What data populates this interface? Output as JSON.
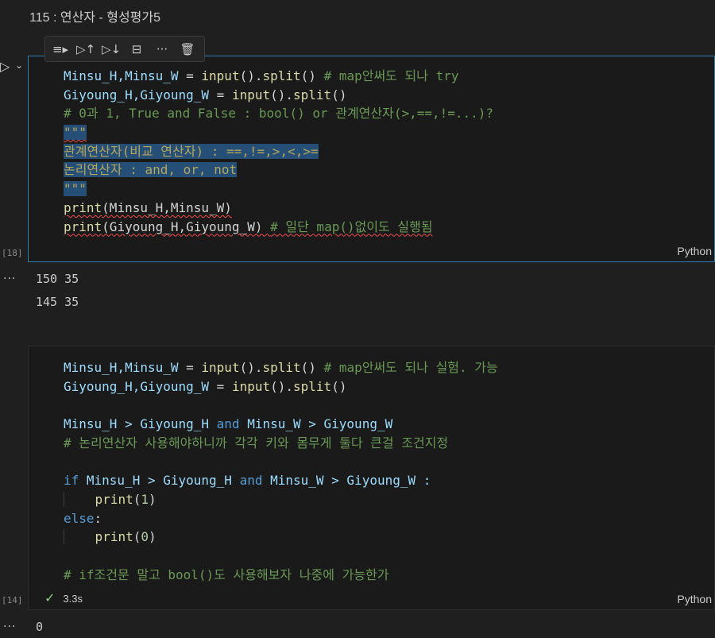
{
  "header": {
    "title": "115 : 연산자 - 형성평가5"
  },
  "toolbar": {
    "run_by_line_icon": "≡▸",
    "run_above_icon": "▷↑",
    "run_below_icon": "▷↓",
    "split_icon": "⊟",
    "more_icon": "···",
    "delete_icon": "🗑"
  },
  "cell1": {
    "exec_count": "[18]",
    "language": "Python",
    "lines": [
      {
        "a": "Minsu_H,Minsu_W",
        "b": " = ",
        "c": "input",
        "d": "().",
        "e": "split",
        "f": "() ",
        "g": "# map안써도 되나 try"
      },
      {
        "a": "Giyoung_H,Giyoung_W",
        "b": " = ",
        "c": "input",
        "d": "().",
        "e": "split",
        "f": "()"
      },
      {
        "text": "# 0과 1, True and False : bool() or 관계연산자(>,==,!=...)?"
      },
      {
        "text": "\"\"\""
      },
      {
        "text": "관계연산자(비교 연산자) : ==,!=,>,<,>="
      },
      {
        "text": "논리연산자 : and, or, not"
      },
      {
        "text": "\"\"\""
      },
      {
        "fn": "print",
        "args": "(Minsu_H,Minsu_W)"
      },
      {
        "fn": "print",
        "args": "(Giyoung_H,Giyoung_W) ",
        "comment": "# 일단 map()없이도 실행됨"
      }
    ],
    "output": [
      "150 35",
      "145 35"
    ]
  },
  "cell2": {
    "exec_count": "[14]",
    "language": "Python",
    "duration": "3.3s",
    "lines": {
      "l1_vars": "Minsu_H,Minsu_W",
      "l1_eq": " = ",
      "l1_fn": "input",
      "l1_mid": "().",
      "l1_fn2": "split",
      "l1_end": "() ",
      "l1_comment": "# map안써도 되나 실험. 가능",
      "l2_vars": "Giyoung_H,Giyoung_W",
      "l2_eq": " = ",
      "l2_fn": "input",
      "l2_mid": "().",
      "l2_fn2": "split",
      "l2_end": "()",
      "l4_a": "Minsu_H > Giyoung_H ",
      "l4_and": "and",
      "l4_b": " Minsu_W > Giyoung_W",
      "l5_comment": "# 논리연산자 사용해야하니까 각각 키와 몸무게 둘다 큰걸 조건지정",
      "l7_if": "if",
      "l7_a": " Minsu_H > Giyoung_H ",
      "l7_and": "and",
      "l7_b": " Minsu_W > Giyoung_W :",
      "l8_fn": "print",
      "l8_open": "(",
      "l8_num": "1",
      "l8_close": ")",
      "l9_else": "else",
      "l9_colon": ":",
      "l10_fn": "print",
      "l10_open": "(",
      "l10_num": "0",
      "l10_close": ")",
      "l12_comment": "# if조건문 말고 bool()도 사용해보자 나중에 가능한가"
    },
    "output": [
      "0"
    ]
  },
  "output_dots": "···"
}
